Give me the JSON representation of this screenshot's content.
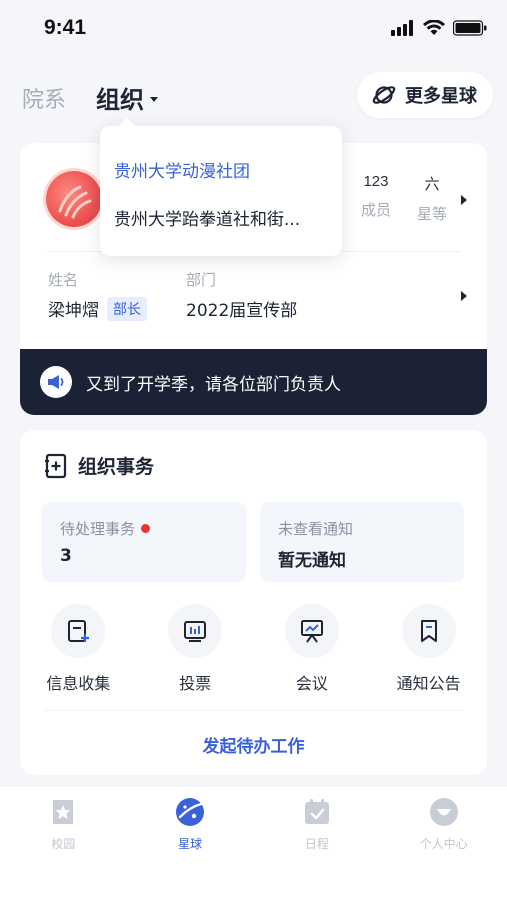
{
  "status": {
    "time": "9:41"
  },
  "nav": {
    "tab_inactive": "院系",
    "tab_active": "组织",
    "more_button": "更多星球"
  },
  "dropdown": {
    "items": [
      "贵州大学动漫社团",
      "贵州大学跆拳道社和街..."
    ]
  },
  "org": {
    "stats": [
      {
        "value": "123",
        "label": "成员"
      },
      {
        "value": "六",
        "label": "星等"
      }
    ],
    "person_name_label": "姓名",
    "person_name": "梁坤熠",
    "role_badge": "部长",
    "dept_label": "部门",
    "dept_value": "2022届宣传部",
    "notice": "又到了开学季，请各位部门负责人"
  },
  "affairs": {
    "title": "组织事务",
    "pending_label": "待处理事务",
    "pending_value": "3",
    "unread_label": "未查看通知",
    "unread_value": "暂无通知",
    "quick_actions": [
      "信息收集",
      "投票",
      "会议",
      "通知公告"
    ],
    "start_link": "发起待办工作"
  },
  "tabbar": {
    "items": [
      "校园",
      "星球",
      "日程",
      "个人中心"
    ],
    "active_index": 1
  },
  "colors": {
    "accent": "#3a62d8",
    "notice_bg": "#1b2235",
    "alert_dot": "#e8342b"
  }
}
